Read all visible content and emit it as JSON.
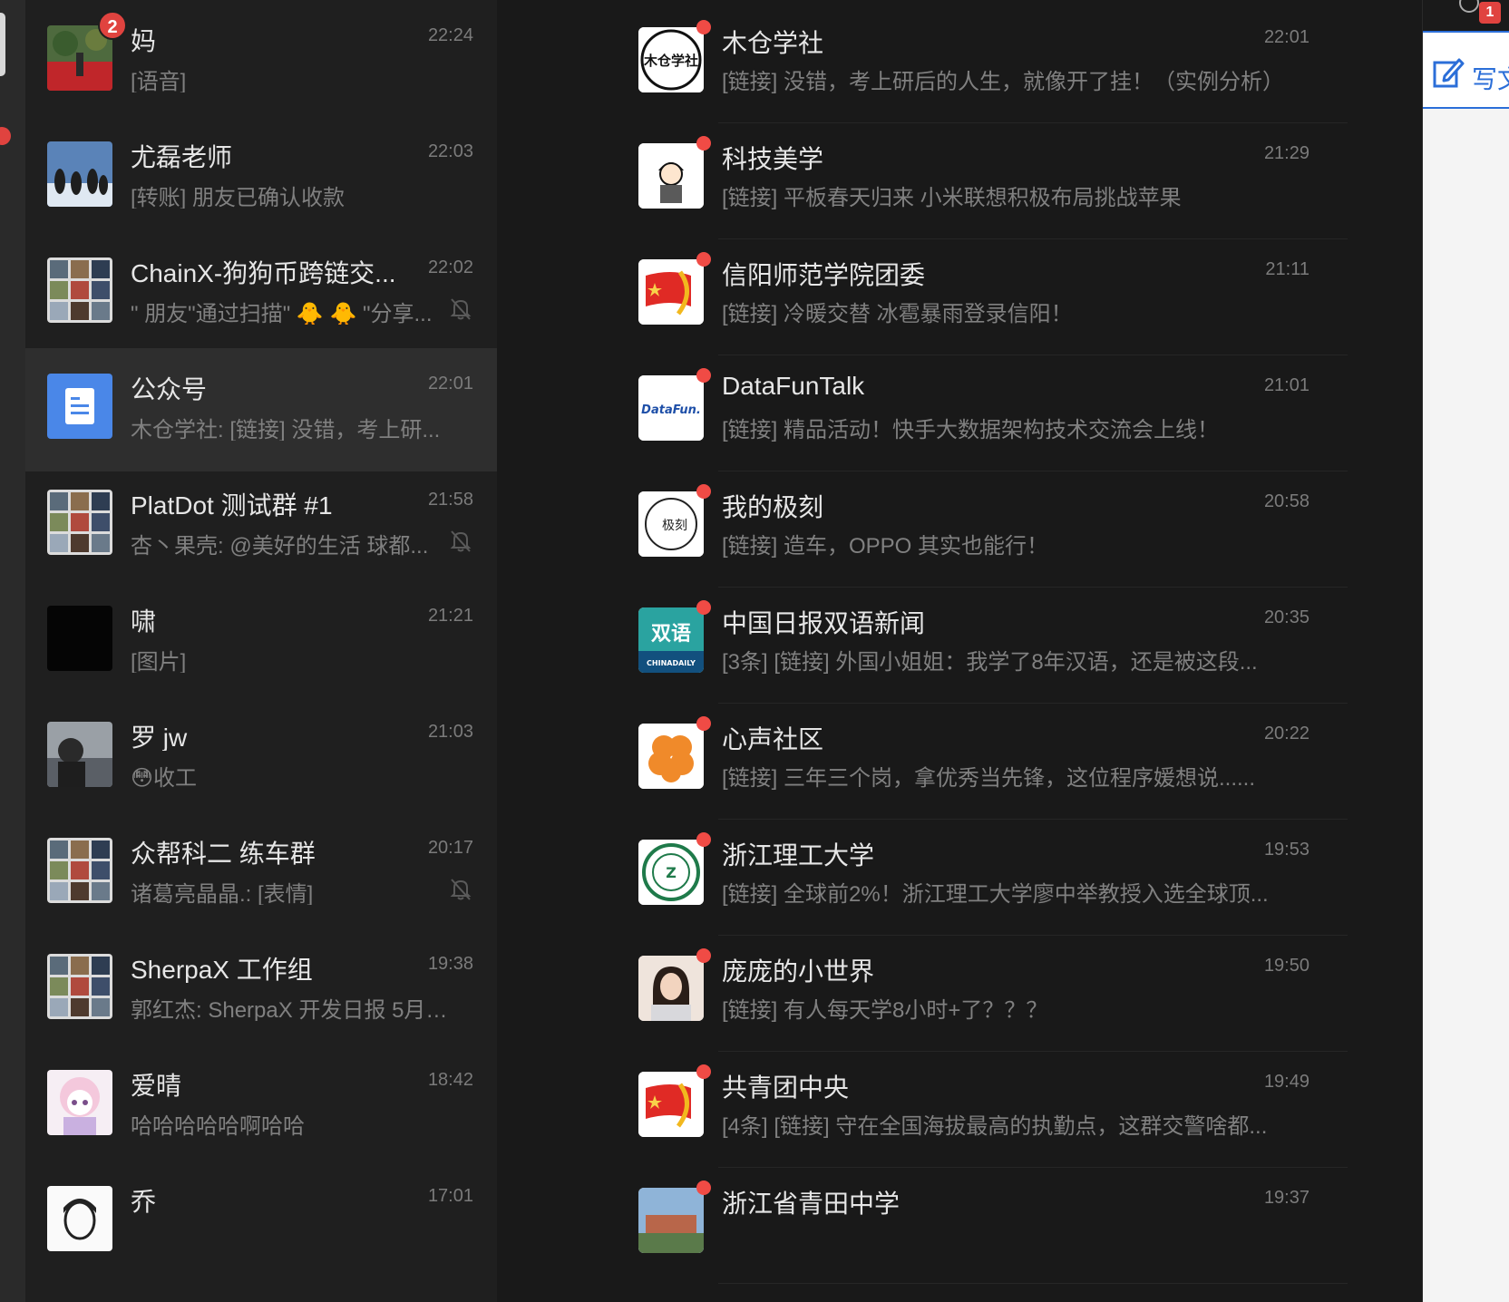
{
  "chat_list": [
    {
      "name": "妈",
      "time": "22:24",
      "preview": "[语音]",
      "badge": "2",
      "muted": false,
      "selected": false,
      "avatar": "photo-flowers"
    },
    {
      "name": "尤磊老师",
      "time": "22:03",
      "preview": "[转账] 朋友已确认收款",
      "badge": "",
      "muted": false,
      "selected": false,
      "avatar": "photo-penguins"
    },
    {
      "name": "ChainX-狗狗币跨链交...",
      "time": "22:02",
      "preview": "\" 朋友\"通过扫描\" 🐥 🐥 \"分享...",
      "badge": "",
      "muted": true,
      "selected": false,
      "avatar": "group-grid"
    },
    {
      "name": "公众号",
      "time": "22:01",
      "preview": "木仓学社: [链接] 没错，考上研...",
      "badge": "",
      "muted": false,
      "selected": true,
      "avatar": "official-accounts-doc"
    },
    {
      "name": "PlatDot 测试群 #1",
      "time": "21:58",
      "preview": "杏丶果壳: @美好的生活 球都...",
      "badge": "",
      "muted": true,
      "selected": false,
      "avatar": "group-grid"
    },
    {
      "name": "啸",
      "time": "21:21",
      "preview": "[图片]",
      "badge": "",
      "muted": false,
      "selected": false,
      "avatar": "black-square"
    },
    {
      "name": "罗 jw",
      "time": "21:03",
      "preview": "😳收工",
      "badge": "",
      "muted": false,
      "selected": false,
      "avatar": "photo-person"
    },
    {
      "name": "众帮科二 练车群",
      "time": "20:17",
      "preview": "诸葛亮晶晶.: [表情]",
      "badge": "",
      "muted": true,
      "selected": false,
      "avatar": "group-grid"
    },
    {
      "name": "SherpaX 工作组",
      "time": "19:38",
      "preview": "郭红杰: SherpaX 开发日报 5月1...",
      "badge": "",
      "muted": false,
      "selected": false,
      "avatar": "group-grid"
    },
    {
      "name": "爱晴",
      "time": "18:42",
      "preview": "哈哈哈哈哈啊哈哈",
      "badge": "",
      "muted": false,
      "selected": false,
      "avatar": "anime-girl"
    },
    {
      "name": "乔",
      "time": "17:01",
      "preview": "",
      "badge": "",
      "muted": false,
      "selected": false,
      "avatar": "cartoon-man"
    }
  ],
  "articles": [
    {
      "title": "木仓学社",
      "time": "22:01",
      "summary": "[链接] 没错，考上研后的人生，就像开了挂！（实例分析）",
      "avatar": "mucang-logo",
      "avatar_text": "木仓学社"
    },
    {
      "title": "科技美学",
      "time": "21:29",
      "summary": "[链接] 平板春天归来 小米联想积极布局挑战苹果",
      "avatar": "cartoon-boy-logo",
      "avatar_text": ""
    },
    {
      "title": "信阳师范学院团委",
      "time": "21:11",
      "summary": "[链接] 冷暖交替 冰雹暴雨登录信阳！",
      "avatar": "youth-league-flag-logo",
      "avatar_text": ""
    },
    {
      "title": "DataFunTalk",
      "time": "21:01",
      "summary": "[链接] 精品活动！快手大数据架构技术交流会上线！",
      "avatar": "datafun-logo",
      "avatar_text": "DataFun."
    },
    {
      "title": "我的极刻",
      "time": "20:58",
      "summary": "[链接] 造车，OPPO 其实也能行！",
      "avatar": "jike-logo",
      "avatar_text": "极刻"
    },
    {
      "title": "中国日报双语新闻",
      "time": "20:35",
      "summary": "[3条] [链接] 外国小姐姐：我学了8年汉语，还是被这段...",
      "avatar": "chinadaily-logo",
      "avatar_text": "双语"
    },
    {
      "title": "心声社区",
      "time": "20:22",
      "summary": "[链接] 三年三个岗，拿优秀当先锋，这位程序媛想说......",
      "avatar": "flower-logo",
      "avatar_text": ""
    },
    {
      "title": "浙江理工大学",
      "time": "19:53",
      "summary": "[链接] 全球前2%！浙江理工大学廖中举教授入选全球顶...",
      "avatar": "university-seal-logo",
      "avatar_text": ""
    },
    {
      "title": "庞庞的小世界",
      "time": "19:50",
      "summary": "[链接] 有人每天学8小时+了？？？",
      "avatar": "portrait-woman",
      "avatar_text": ""
    },
    {
      "title": "共青团中央",
      "time": "19:49",
      "summary": "[4条] [链接] 守在全国海拔最高的执勤点，这群交警啥都...",
      "avatar": "youth-league-flag-logo",
      "avatar_text": ""
    },
    {
      "title": "浙江省青田中学",
      "time": "19:37",
      "summary": "",
      "avatar": "campus-photo",
      "avatar_text": ""
    }
  ],
  "right_panel": {
    "notify_badge": "1",
    "write_label": "写文"
  },
  "colors": {
    "badge_red": "#e0433f",
    "unread_dot": "#f04b45",
    "accent_blue": "#2b6ed8",
    "selected_row": "#2e2e2e"
  }
}
